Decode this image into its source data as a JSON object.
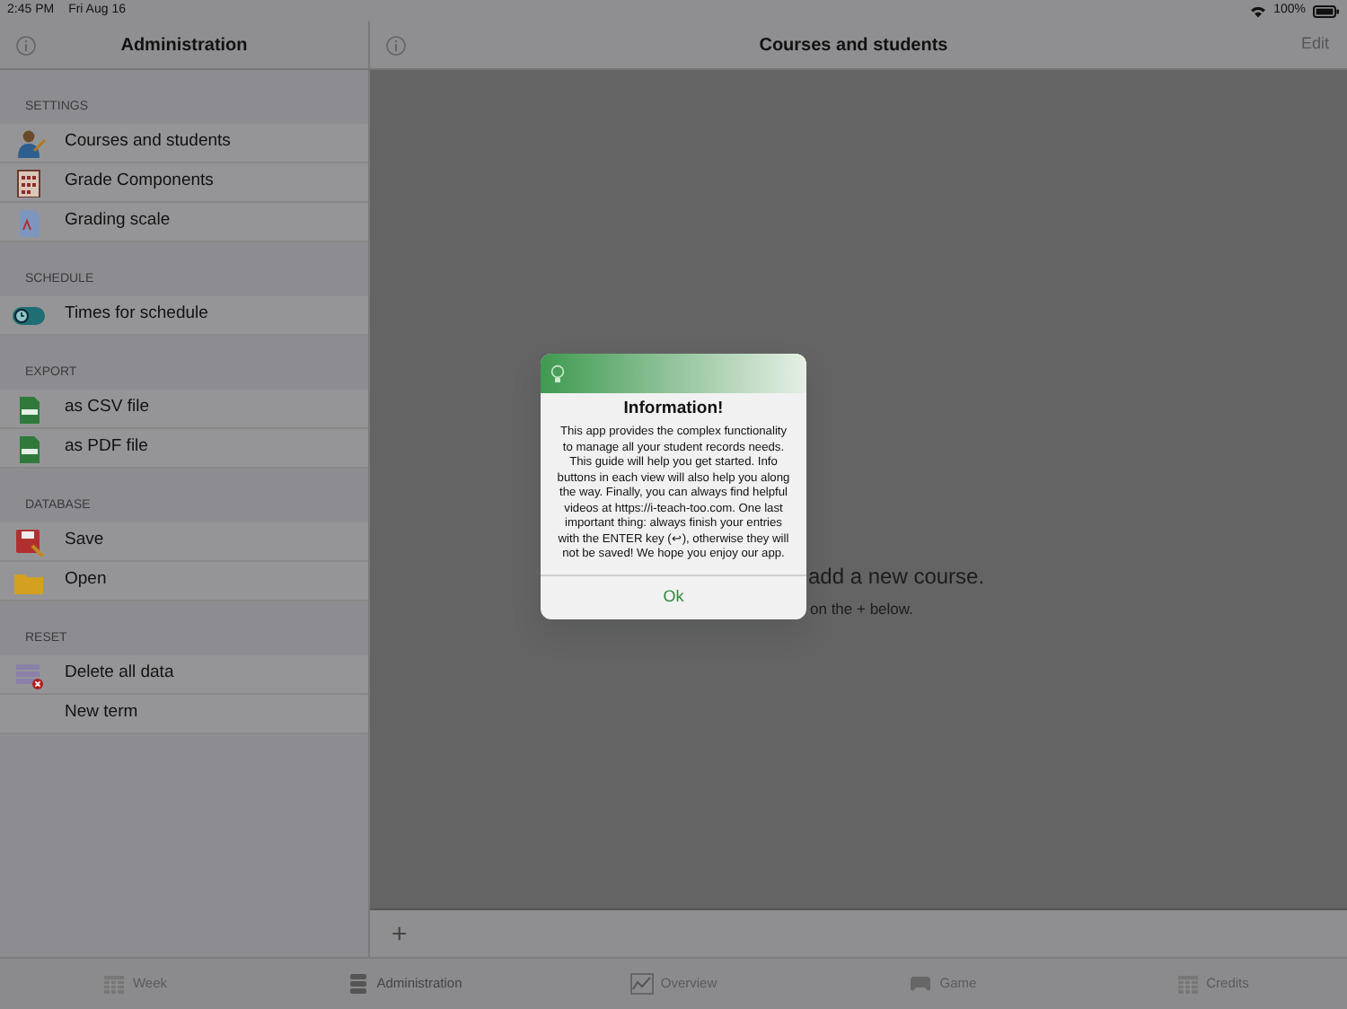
{
  "status_bar": {
    "time": "2:45 PM",
    "date": "Fri Aug 16",
    "battery": "100%"
  },
  "sidebar": {
    "title": "Administration",
    "sections": [
      {
        "header": "SETTINGS",
        "items": [
          {
            "label": "Courses and students",
            "selected": false
          },
          {
            "label": "Grade Components",
            "selected": false
          },
          {
            "label": "Grading scale",
            "selected": false
          }
        ]
      },
      {
        "header": "SCHEDULE",
        "items": [
          {
            "label": "Times for schedule",
            "selected": false
          }
        ]
      },
      {
        "header": "EXPORT",
        "items": [
          {
            "label": "as CSV file",
            "selected": false
          },
          {
            "label": "as PDF file",
            "selected": false
          }
        ]
      },
      {
        "header": "DATABASE",
        "items": [
          {
            "label": "Save",
            "selected": false
          },
          {
            "label": "Open",
            "selected": false
          }
        ]
      },
      {
        "header": "RESET",
        "items": [
          {
            "label": "Delete all data",
            "selected": false
          },
          {
            "label": "New term",
            "selected": false
          }
        ]
      }
    ]
  },
  "main": {
    "title": "Courses and students",
    "edit": "Edit",
    "empty_title": "add a new course.",
    "empty_hint": "on the + below.",
    "add": "+"
  },
  "dialog": {
    "title": "Information!",
    "message": "This app provides the complex functionality to manage all your student records needs. This guide will help you get started. Info buttons in each view will also help you along the way. Finally, you can always find helpful videos at https://i-teach-too.com. One last important thing: always finish your entries with the ENTER key (↩), otherwise they will not be saved! We hope you enjoy our app.",
    "button": "Ok"
  },
  "tab_bar": [
    {
      "label": "Week",
      "selected": false
    },
    {
      "label": "Administration",
      "selected": true
    },
    {
      "label": "Overview",
      "selected": false
    },
    {
      "label": "Game",
      "selected": false
    },
    {
      "label": "Credits",
      "selected": false
    }
  ]
}
